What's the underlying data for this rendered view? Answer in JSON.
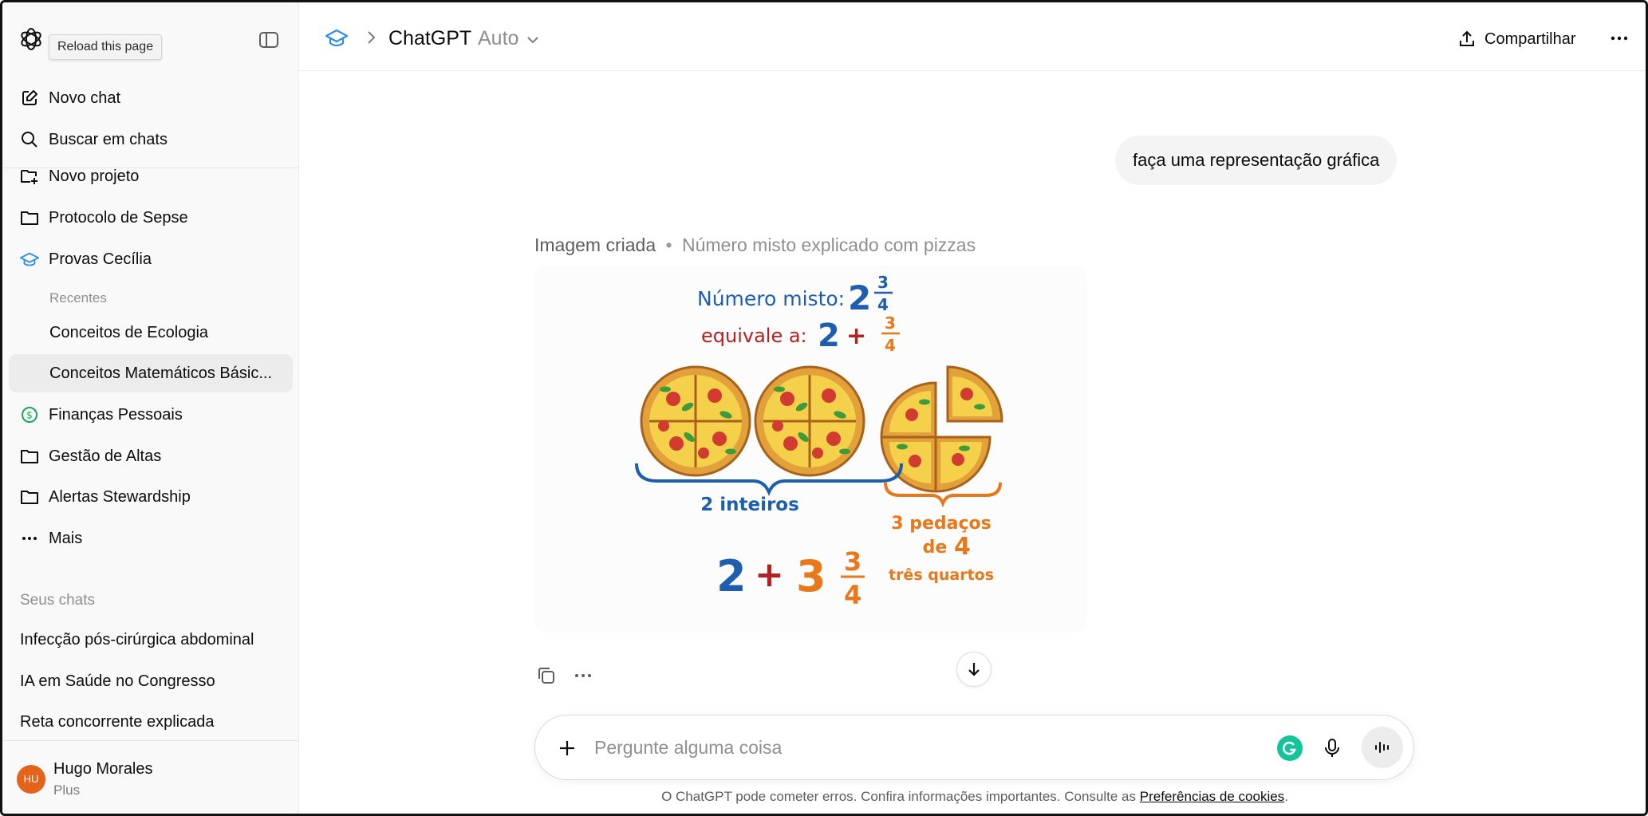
{
  "app": {
    "tooltip": "Reload this page"
  },
  "sidebar": {
    "items": [
      {
        "label": "Novo chat",
        "icon": "edit-icon"
      },
      {
        "label": "Buscar em chats",
        "icon": "search-icon"
      },
      {
        "label": "Novo projeto",
        "icon": "folder-plus-icon"
      },
      {
        "label": "Protocolo de Sepse",
        "icon": "folder-icon"
      },
      {
        "label": "Provas Cecília",
        "icon": "graduation-cap-icon"
      }
    ],
    "recent_label": "Recentes",
    "recent": [
      {
        "label": "Conceitos de Ecologia"
      },
      {
        "label": "Conceitos Matemáticos Básic..."
      }
    ],
    "projects": [
      {
        "label": "Finanças Pessoais",
        "icon": "dollar-icon"
      },
      {
        "label": "Gestão de Altas",
        "icon": "folder-icon"
      },
      {
        "label": "Alertas Stewardship",
        "icon": "folder-icon"
      },
      {
        "label": "Mais",
        "icon": "ellipsis-icon"
      }
    ],
    "chats_section": "Seus chats",
    "chats": [
      {
        "label": "Infecção pós-cirúrgica abdominal"
      },
      {
        "label": "IA em Saúde no Congresso"
      },
      {
        "label": "Reta concorrente explicada"
      }
    ],
    "user": {
      "initials": "HU",
      "name": "Hugo Morales",
      "plan": "Plus"
    }
  },
  "header": {
    "title": "ChatGPT",
    "model": "Auto",
    "share_label": "Compartilhar"
  },
  "conversation": {
    "user_message": "faça uma representação gráfica",
    "image_caption": "Imagem criada",
    "image_separator": "•",
    "image_description": "Número misto explicado com pizzas",
    "image_text": {
      "line1_label": "Número misto:",
      "line1_whole": "2",
      "line1_num": "3",
      "line1_den": "4",
      "line2_label": "equivale a:",
      "line2_whole": "2",
      "line2_plus": "+",
      "line2_num": "3",
      "line2_den": "4",
      "wholes_label": "2 inteiros",
      "pieces_line1": "3 pedaços",
      "pieces_line2_prefix": "de",
      "pieces_line2_num": "4",
      "bottom_whole": "2",
      "bottom_plus": "+",
      "bottom_three": "3",
      "bottom_num": "3",
      "bottom_den": "4",
      "words": "três quartos"
    }
  },
  "composer": {
    "placeholder": "Pergunte alguma coisa"
  },
  "footer": {
    "disclaimer": "O ChatGPT pode cometer erros. Confira informações importantes. Consulte as",
    "link": "Preferências de cookies",
    "end": "."
  },
  "colors": {
    "blue": "#1d5fae",
    "red": "#b32121",
    "orange": "#e8781a",
    "accent_blue": "#2f8cf0",
    "finance_green": "#19a85a"
  }
}
